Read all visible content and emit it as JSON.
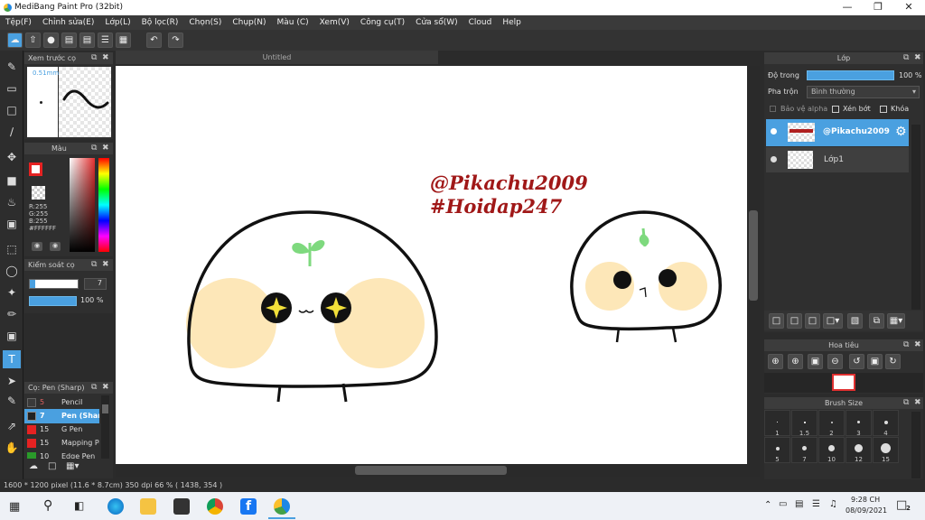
{
  "window": {
    "title": "MediBang Paint Pro (32bit)",
    "minimize_icon": "minimize-icon",
    "maximize_icon": "maximize-icon",
    "close_icon": "close-icon"
  },
  "menu": [
    "Tệp(F)",
    "Chỉnh sửa(E)",
    "Lớp(L)",
    "Bộ lọc(R)",
    "Chọn(S)",
    "Chụp(N)",
    "Màu (C)",
    "Xem(V)",
    "Công cụ(T)",
    "Cửa sổ(W)",
    "Cloud",
    "Help"
  ],
  "canvas_tab": {
    "title": "Untitled"
  },
  "brush_preview": {
    "title": "Xem trước cọ",
    "size": "0.51mm"
  },
  "color_panel": {
    "title": "Màu",
    "r": "R:255",
    "g": "G:255",
    "b": "B:255",
    "hex": "#FFFFFF",
    "fg": "#e52222",
    "bg": "#ffffff"
  },
  "brush_control": {
    "title": "Kiểm soát cọ",
    "size": "7",
    "opacity": "100 %"
  },
  "brush_list": {
    "title": "Cọ: Pen (Sharp)",
    "items": [
      {
        "size": "5",
        "name": "Pencil",
        "color": "#3a3a3a"
      },
      {
        "size": "7",
        "name": "Pen (Sharp)",
        "color": "#222222"
      },
      {
        "size": "15",
        "name": "G Pen",
        "color": "#e52222"
      },
      {
        "size": "15",
        "name": "Mapping Pen",
        "color": "#e52222"
      },
      {
        "size": "10",
        "name": "Edge Pen",
        "color": "#2a9a2a"
      }
    ]
  },
  "canvas_text": {
    "line1": "@Pikachu2009",
    "line2": "#Hoidap247"
  },
  "layer_panel": {
    "title": "Lớp",
    "opacity_label": "Độ trong",
    "opacity_value": "100 %",
    "blend_label": "Pha trộn",
    "blend_value": "Bình thường",
    "protect_alpha": "Bảo vệ alpha",
    "clipping": "Xén bớt",
    "lock": "Khóa",
    "layers": [
      {
        "name": "@Pikachu2009",
        "selected": true
      },
      {
        "name": "Lớp1",
        "selected": false
      }
    ]
  },
  "navigator": {
    "title": "Hoa tiêu"
  },
  "brush_size": {
    "title": "Brush Size",
    "sizes": [
      "1",
      "1.5",
      "2",
      "3",
      "4",
      "5",
      "7",
      "10",
      "12",
      "15"
    ]
  },
  "status": {
    "text": "1600 * 1200 pixel   (11.6 * 8.7cm)   350 dpi   66 %   ( 1438, 354 )"
  },
  "taskbar": {
    "time": "9:28 CH",
    "date": "08/09/2021",
    "notification_count": "2"
  },
  "colors": {
    "accent": "#4aa0e0",
    "text_red": "#a01818",
    "sprout": "#7ed97e",
    "cheek": "#fde7b8",
    "sparkle": "#f2e03a"
  }
}
